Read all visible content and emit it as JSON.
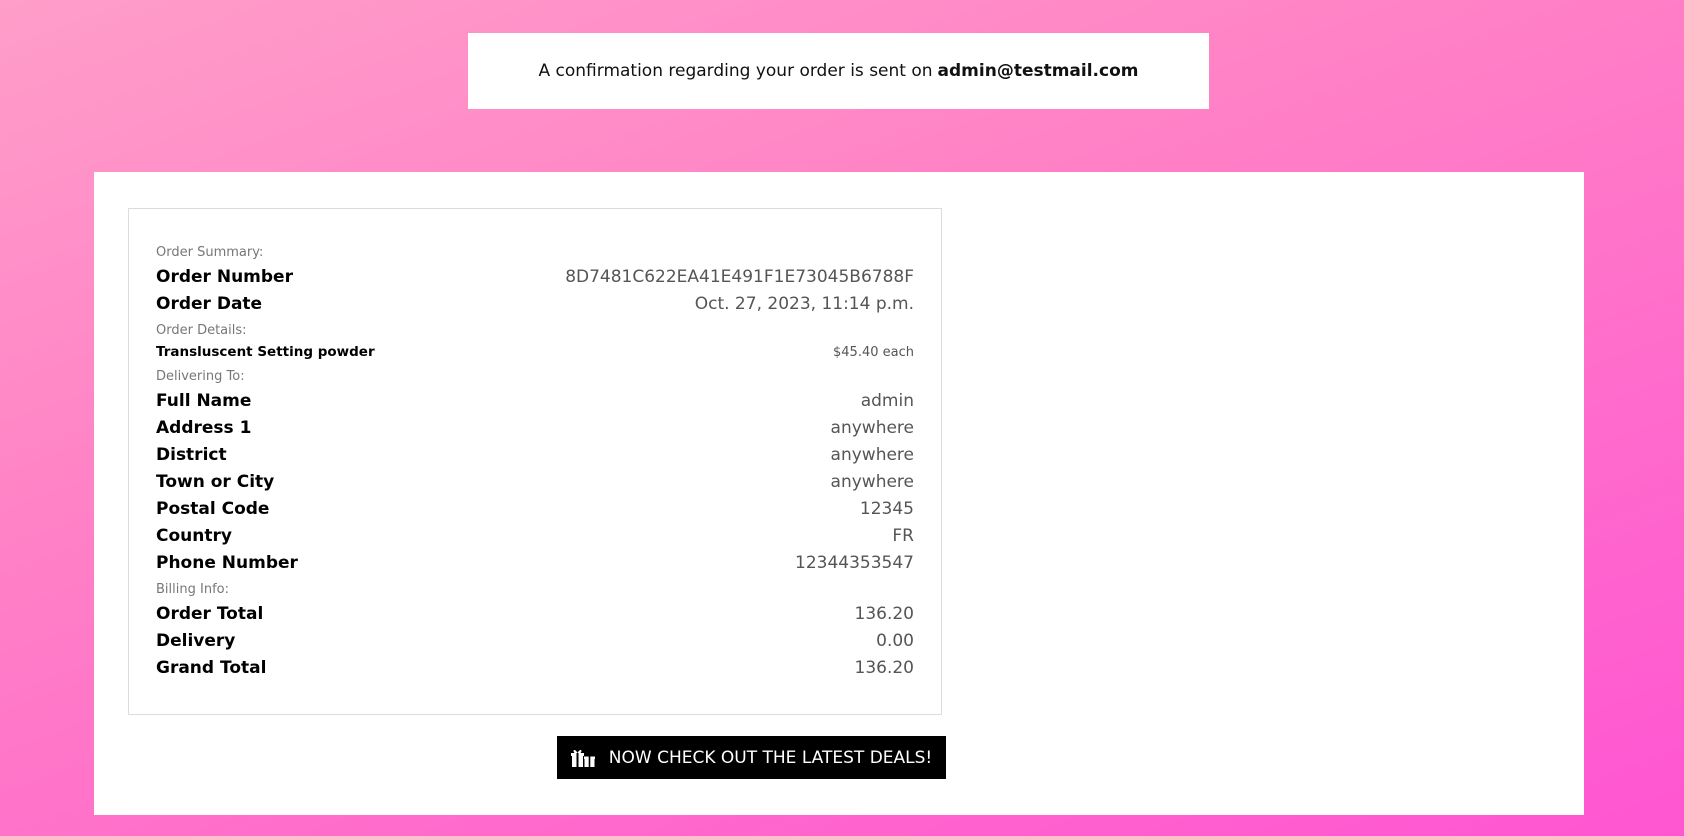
{
  "banner": {
    "text": "A confirmation regarding your order is sent on",
    "email": "admin@testmail.com"
  },
  "summary": {
    "order_summary_label": "Order Summary:",
    "order_number_label": "Order Number",
    "order_number": "8D7481C622EA41E491F1E73045B6788F",
    "order_date_label": "Order Date",
    "order_date": "Oct. 27, 2023, 11:14 p.m.",
    "order_details_label": "Order Details:",
    "items": [
      {
        "name": "Transluscent Setting powder",
        "price": "$45.40 each"
      }
    ],
    "delivering_label": "Delivering To:",
    "delivery": [
      {
        "label": "Full Name",
        "value": "admin"
      },
      {
        "label": "Address 1",
        "value": "anywhere"
      },
      {
        "label": "District",
        "value": "anywhere"
      },
      {
        "label": "Town or City",
        "value": "anywhere"
      },
      {
        "label": "Postal Code",
        "value": "12345"
      },
      {
        "label": "Country",
        "value": "FR"
      },
      {
        "label": "Phone Number",
        "value": "12344353547"
      }
    ],
    "billing_label": "Billing Info:",
    "billing": [
      {
        "label": "Order Total",
        "value": "136.20"
      },
      {
        "label": "Delivery",
        "value": "0.00"
      },
      {
        "label": "Grand Total",
        "value": "136.20"
      }
    ]
  },
  "deals_button": {
    "label": "NOW CHECK OUT THE LATEST DEALS!",
    "icon": "gifts-icon"
  },
  "colors": {
    "background_start": "#ff9ec9",
    "background_end": "#ff55d2",
    "button": "#000000"
  }
}
